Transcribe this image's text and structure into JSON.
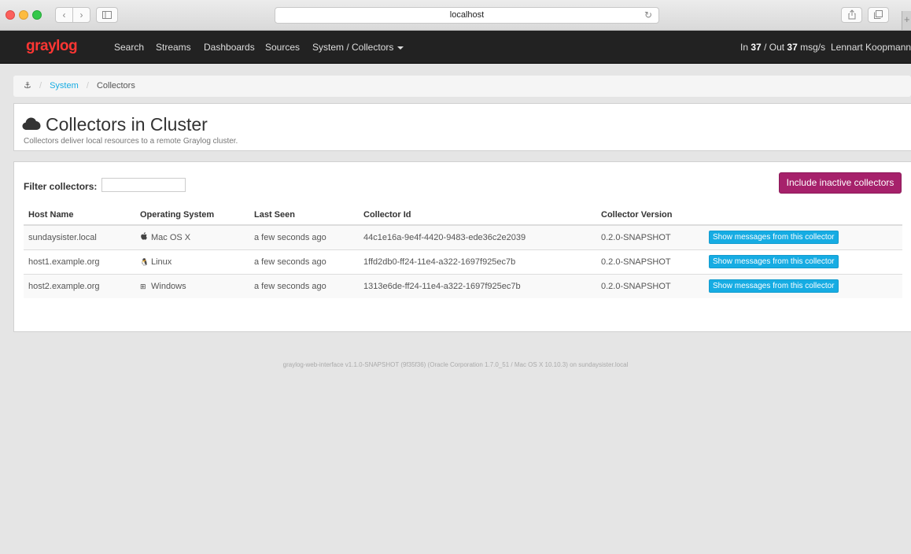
{
  "browser": {
    "url": "localhost",
    "back_icon": "‹",
    "forward_icon": "›",
    "reload_icon": "↻"
  },
  "navbar": {
    "brand_prefix": "gray",
    "brand_suffix": "log",
    "items": [
      {
        "label": "Search"
      },
      {
        "label": "Streams"
      },
      {
        "label": "Dashboards"
      },
      {
        "label": "Sources"
      },
      {
        "label": "System / Collectors"
      }
    ],
    "throughput": {
      "in_label": "In",
      "in_value": "37",
      "sep": "/ Out",
      "out_value": "37",
      "unit": "msg/s"
    },
    "user": "Lennart Koopmann"
  },
  "breadcrumb": {
    "home_icon": "⚓",
    "items": [
      "System",
      "Collectors"
    ]
  },
  "header": {
    "title": "Collectors in Cluster",
    "subtitle": "Collectors deliver local resources to a remote Graylog cluster."
  },
  "filter": {
    "label": "Filter collectors:",
    "value": ""
  },
  "include_button": "Include inactive collectors",
  "table": {
    "columns": [
      "Host Name",
      "Operating System",
      "Last Seen",
      "Collector Id",
      "Collector Version"
    ],
    "rows": [
      {
        "host": "sundaysister.local",
        "os_icon": "apple-icon",
        "os_glyph": "",
        "os": "Mac OS X",
        "last_seen": "a few seconds ago",
        "id": "44c1e16a-9e4f-4420-9483-ede36c2e2039",
        "version": "0.2.0-SNAPSHOT",
        "action": "Show messages from this collector"
      },
      {
        "host": "host1.example.org",
        "os_icon": "linux-icon",
        "os_glyph": "🐧",
        "os": "Linux",
        "last_seen": "a few seconds ago",
        "id": "1ffd2db0-ff24-11e4-a322-1697f925ec7b",
        "version": "0.2.0-SNAPSHOT",
        "action": "Show messages from this collector"
      },
      {
        "host": "host2.example.org",
        "os_icon": "windows-icon",
        "os_glyph": "⊞",
        "os": "Windows",
        "last_seen": "a few seconds ago",
        "id": "1313e6de-ff24-11e4-a322-1697f925ec7b",
        "version": "0.2.0-SNAPSHOT",
        "action": "Show messages from this collector"
      }
    ]
  },
  "footer": "graylog-web-interface v1.1.0-SNAPSHOT (9f35f36) (Oracle Corporation 1.7.0_51 / Mac OS X 10.10.3) on sundaysister.local",
  "colors": {
    "navbar": "#222222",
    "brand": "#ff3633",
    "primary_button": "#a6216b",
    "info_button": "#16ace3"
  }
}
